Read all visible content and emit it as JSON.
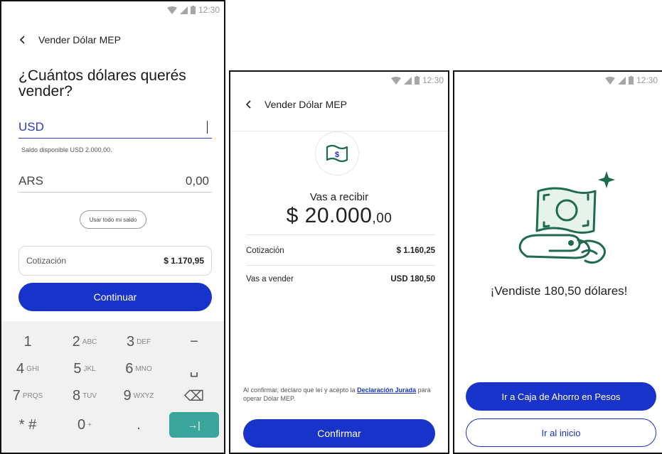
{
  "status_bar": {
    "time": "12:30"
  },
  "colors": {
    "primary": "#1733c9",
    "accent_green": "#3aa69b",
    "illustration_green": "#1f6b4d"
  },
  "screen1": {
    "title": "Vender Dólar MEP",
    "question": "¿Cuántos dólares querés vender?",
    "usd_label": "USD",
    "saldo_text": "Saldo disponible USD 2.000,00.",
    "ars_label": "ARS",
    "ars_value": "0,00",
    "use_all_label": "Usar todo mi saldo",
    "cotizacion_label": "Cotización",
    "cotizacion_value": "$ 1.170,95",
    "continue_label": "Continuar",
    "keypad": [
      {
        "digit": "1",
        "letters": ""
      },
      {
        "digit": "2",
        "letters": "ABC"
      },
      {
        "digit": "3",
        "letters": "DEF"
      },
      {
        "digit": "−",
        "letters": ""
      },
      {
        "digit": "4",
        "letters": "GHI"
      },
      {
        "digit": "5",
        "letters": "JKL"
      },
      {
        "digit": "6",
        "letters": "MNO"
      },
      {
        "digit": "␣",
        "letters": ""
      },
      {
        "digit": "7",
        "letters": "PRQS"
      },
      {
        "digit": "8",
        "letters": "TUV"
      },
      {
        "digit": "9",
        "letters": "WXYZ"
      },
      {
        "digit": "⌫",
        "letters": ""
      },
      {
        "digit": "* #",
        "letters": ""
      },
      {
        "digit": "0",
        "letters": "+"
      },
      {
        "digit": ".",
        "letters": ""
      },
      {
        "digit": "→|",
        "letters": ""
      }
    ]
  },
  "screen2": {
    "title": "Vender Dólar MEP",
    "recibir_label": "Vas a recibir",
    "recibir_main": "$ 20.000",
    "recibir_cents": ",00",
    "cotizacion_label": "Cotización",
    "cotizacion_value": "$ 1.160,25",
    "vender_label": "Vas a vender",
    "vender_value": "USD 180,50",
    "legal_prefix": "Al confirmar, declaro que leí y acepto la",
    "legal_link": "Declaración Jurada",
    "legal_suffix": "para operar Dólar MEP.",
    "confirm_label": "Confirmar"
  },
  "screen3": {
    "success_message": "¡Vendiste 180,50 dólares!",
    "caja_label": "Ir a Caja de Ahorro en Pesos",
    "inicio_label": "Ir al inicio"
  }
}
